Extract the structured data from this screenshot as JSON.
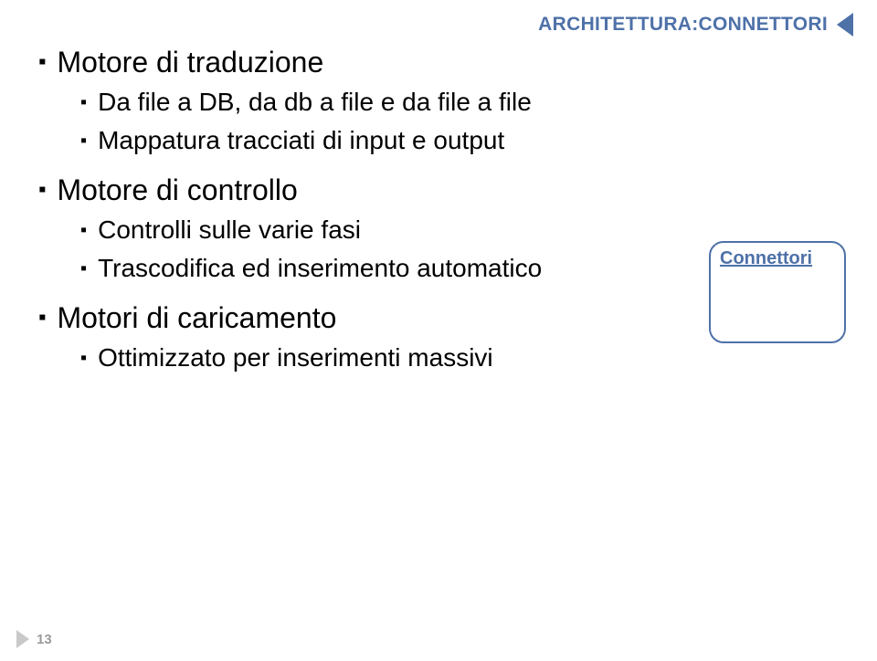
{
  "header": {
    "title": "ARCHITETTURA:CONNETTORI"
  },
  "content": {
    "items": [
      {
        "label": "Motore di traduzione",
        "children": [
          {
            "label": "Da file a DB, da db a file e da file a file"
          },
          {
            "label": "Mappatura tracciati di input e output"
          }
        ]
      },
      {
        "label": "Motore di controllo",
        "children": [
          {
            "label": "Controlli sulle varie fasi"
          },
          {
            "label": "Trascodifica ed inserimento automatico"
          }
        ]
      },
      {
        "label": "Motori di caricamento",
        "children": [
          {
            "label": "Ottimizzato per inserimenti massivi"
          }
        ]
      }
    ]
  },
  "tag": {
    "label": "Connettori"
  },
  "page": {
    "number": "13"
  }
}
